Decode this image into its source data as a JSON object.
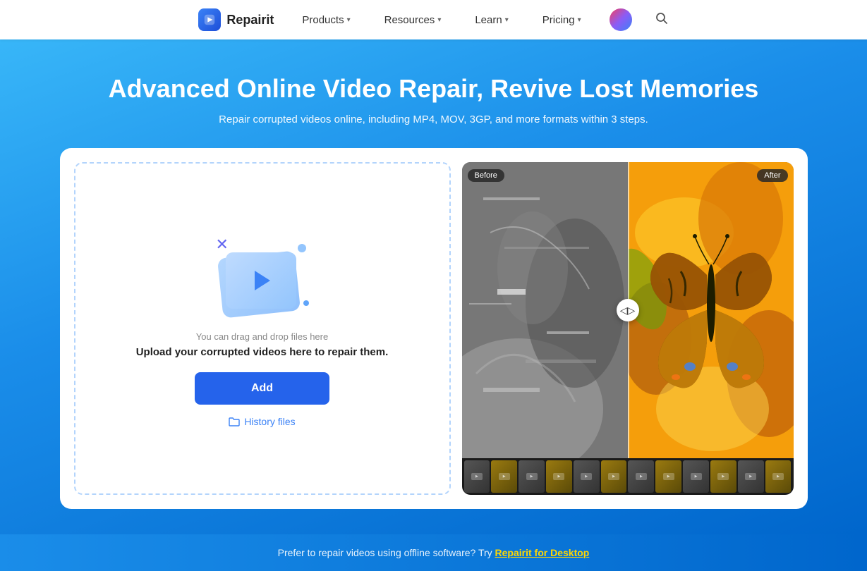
{
  "navbar": {
    "logo_text": "Repairit",
    "products_label": "Products",
    "resources_label": "Resources",
    "learn_label": "Learn",
    "pricing_label": "Pricing"
  },
  "hero": {
    "title": "Advanced Online Video Repair, Revive Lost Memories",
    "subtitle": "Repair corrupted videos online, including MP4, MOV, 3GP, and more formats within 3 steps."
  },
  "upload_panel": {
    "drag_text": "You can drag and drop files here",
    "prompt_text": "Upload your corrupted videos here to repair them.",
    "add_button_label": "Add",
    "history_label": "History files"
  },
  "compare": {
    "before_badge": "Before",
    "after_badge": "After"
  },
  "footer": {
    "text": "Prefer to repair videos using offline software? Try ",
    "link_text": "Repairit for Desktop"
  }
}
